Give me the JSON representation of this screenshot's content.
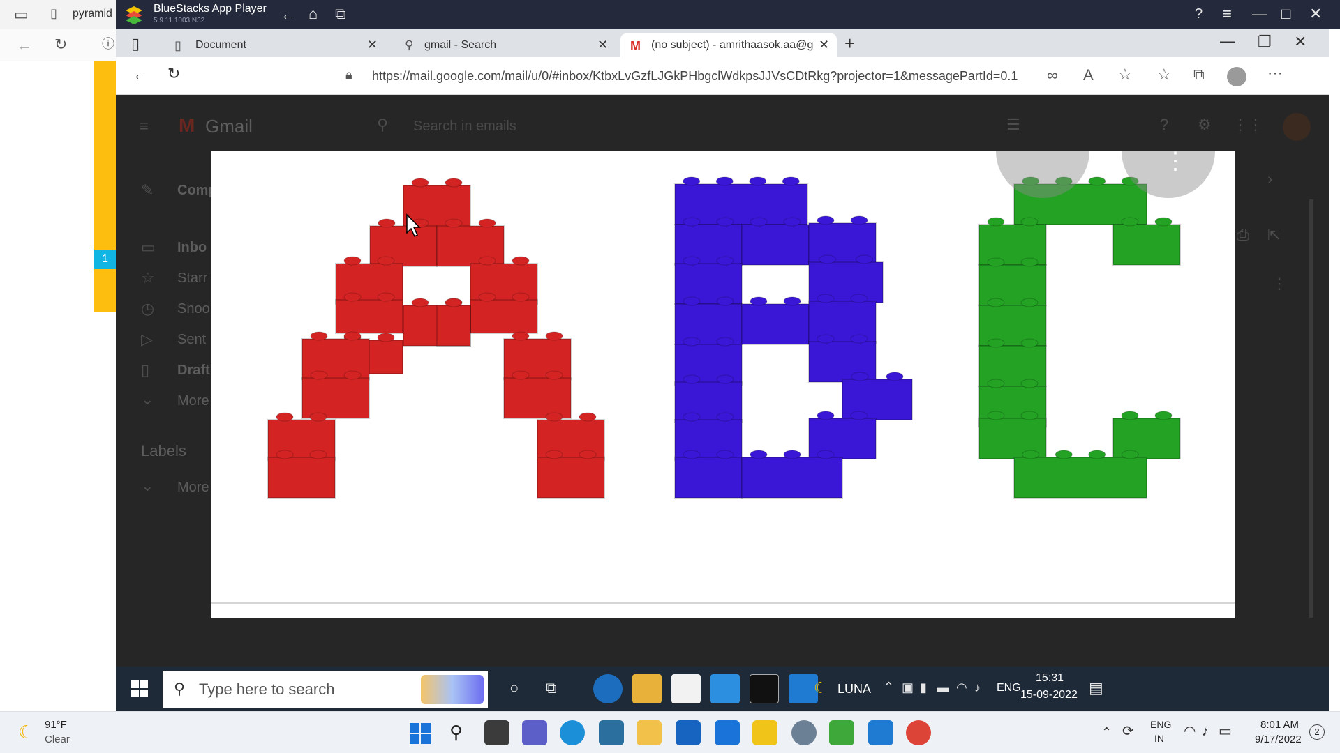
{
  "outer_browser": {
    "tab_label": "pyramid",
    "badge": "1"
  },
  "bluestacks": {
    "title": "BlueStacks App Player",
    "version": "5.9.11.1003  N32"
  },
  "edge": {
    "tabs": [
      {
        "label": "Document"
      },
      {
        "label": "gmail - Search"
      },
      {
        "label": "(no subject) - amrithaasok.aa@g"
      }
    ],
    "url": "https://mail.google.com/mail/u/0/#inbox/KtbxLvGzfLJGkPHbgclWdkpsJJVsCDtRkg?projector=1&messagePartId=0.1"
  },
  "gmail": {
    "logo_text": "Gmail",
    "search_placeholder": "Search in emails",
    "compose": "Comp",
    "nav": [
      "Inbo",
      "Starr",
      "Snoo",
      "Sent",
      "Draft",
      "More"
    ],
    "labels_heading": "Labels",
    "labels_more": "More"
  },
  "viewer": {
    "letters": [
      {
        "letter": "A",
        "color": "#d42323"
      },
      {
        "letter": "B",
        "color": "#3a17d6"
      },
      {
        "letter": "C",
        "color": "#23a224"
      }
    ]
  },
  "inner_taskbar": {
    "search_placeholder": "Type here to search",
    "weather_label": "LUNA",
    "language": "ENG",
    "time": "15:31",
    "date": "15-09-2022"
  },
  "outer_taskbar": {
    "temperature": "91°F",
    "condition": "Clear",
    "lang_line1": "ENG",
    "lang_line2": "IN",
    "time": "8:01 AM",
    "date": "9/17/2022",
    "notifications": "2"
  }
}
